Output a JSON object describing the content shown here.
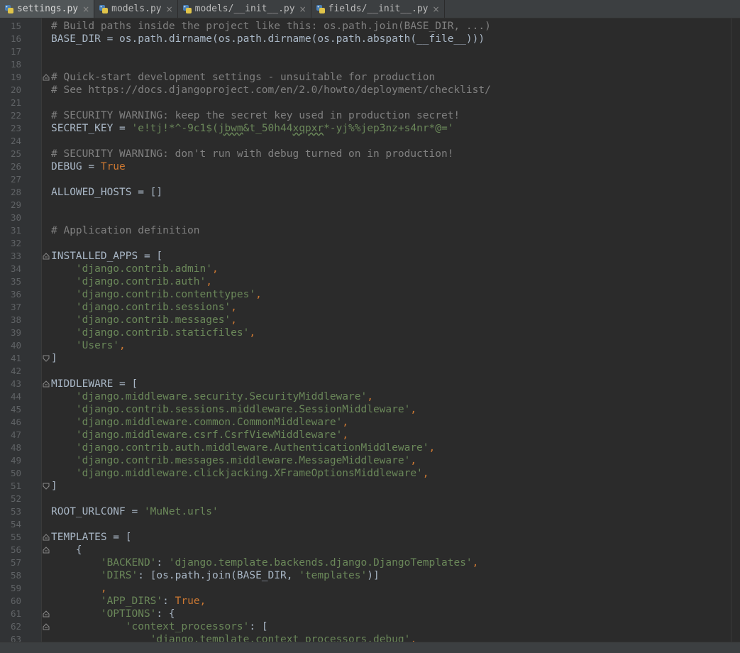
{
  "tabs": [
    {
      "name": "settings.py",
      "active": true
    },
    {
      "name": "models.py",
      "active": false
    },
    {
      "name": "models/__init__.py",
      "active": false
    },
    {
      "name": "fields/__init__.py",
      "active": false
    }
  ],
  "colors": {
    "background": "#2b2b2b",
    "gutter": "#313335",
    "comment": "#808080",
    "string": "#6a8759",
    "keyword": "#cc7832",
    "text": "#a9b7c6"
  },
  "code": {
    "lines": [
      {
        "n": "15",
        "t": "# Build paths inside the project like this: os.path.join(BASE_DIR, ...)",
        "k": "comment"
      },
      {
        "n": "16",
        "t": "BASE_DIR = os.path.dirname(os.path.dirname(os.path.abspath(__file__)))",
        "k": "plain"
      },
      {
        "n": "17",
        "t": "",
        "k": "plain"
      },
      {
        "n": "18",
        "t": "",
        "k": "plain"
      },
      {
        "n": "19",
        "t": "# Quick-start development settings - unsuitable for production",
        "k": "comment"
      },
      {
        "n": "20",
        "t": "# See https://docs.djangoproject.com/en/2.0/howto/deployment/checklist/",
        "k": "comment"
      },
      {
        "n": "21",
        "t": "",
        "k": "plain"
      },
      {
        "n": "22",
        "t": "# SECURITY WARNING: keep the secret key used in production secret!",
        "k": "comment"
      },
      {
        "n": "23",
        "t": "SECRET_KEY = 'e!tj!*^-9c1$(jbwm&t_50h44xqpxr*-yj%%jep3nz+s4nr*@='",
        "k": "assign-string"
      },
      {
        "n": "24",
        "t": "",
        "k": "plain"
      },
      {
        "n": "25",
        "t": "# SECURITY WARNING: don't run with debug turned on in production!",
        "k": "comment"
      },
      {
        "n": "26",
        "t": "DEBUG = True",
        "k": "assign-keyword"
      },
      {
        "n": "27",
        "t": "",
        "k": "plain"
      },
      {
        "n": "28",
        "t": "ALLOWED_HOSTS = []",
        "k": "plain"
      },
      {
        "n": "29",
        "t": "",
        "k": "plain"
      },
      {
        "n": "30",
        "t": "",
        "k": "plain"
      },
      {
        "n": "31",
        "t": "# Application definition",
        "k": "comment"
      },
      {
        "n": "32",
        "t": "",
        "k": "plain"
      },
      {
        "n": "33",
        "t": "INSTALLED_APPS = [",
        "k": "plain"
      },
      {
        "n": "34",
        "t": "    'django.contrib.admin',",
        "k": "string-comma"
      },
      {
        "n": "35",
        "t": "    'django.contrib.auth',",
        "k": "string-comma"
      },
      {
        "n": "36",
        "t": "    'django.contrib.contenttypes',",
        "k": "string-comma"
      },
      {
        "n": "37",
        "t": "    'django.contrib.sessions',",
        "k": "string-comma"
      },
      {
        "n": "38",
        "t": "    'django.contrib.messages',",
        "k": "string-comma"
      },
      {
        "n": "39",
        "t": "    'django.contrib.staticfiles',",
        "k": "string-comma"
      },
      {
        "n": "40",
        "t": "    'Users',",
        "k": "string-comma"
      },
      {
        "n": "41",
        "t": "]",
        "k": "plain"
      },
      {
        "n": "42",
        "t": "",
        "k": "plain"
      },
      {
        "n": "43",
        "t": "MIDDLEWARE = [",
        "k": "plain"
      },
      {
        "n": "44",
        "t": "    'django.middleware.security.SecurityMiddleware',",
        "k": "string-comma"
      },
      {
        "n": "45",
        "t": "    'django.contrib.sessions.middleware.SessionMiddleware',",
        "k": "string-comma"
      },
      {
        "n": "46",
        "t": "    'django.middleware.common.CommonMiddleware',",
        "k": "string-comma"
      },
      {
        "n": "47",
        "t": "    'django.middleware.csrf.CsrfViewMiddleware',",
        "k": "string-comma"
      },
      {
        "n": "48",
        "t": "    'django.contrib.auth.middleware.AuthenticationMiddleware',",
        "k": "string-comma"
      },
      {
        "n": "49",
        "t": "    'django.contrib.messages.middleware.MessageMiddleware',",
        "k": "string-comma"
      },
      {
        "n": "50",
        "t": "    'django.middleware.clickjacking.XFrameOptionsMiddleware',",
        "k": "string-comma"
      },
      {
        "n": "51",
        "t": "]",
        "k": "plain"
      },
      {
        "n": "52",
        "t": "",
        "k": "plain"
      },
      {
        "n": "53",
        "t": "ROOT_URLCONF = 'MuNet.urls'",
        "k": "assign-string"
      },
      {
        "n": "54",
        "t": "",
        "k": "plain"
      },
      {
        "n": "55",
        "t": "TEMPLATES = [",
        "k": "plain"
      },
      {
        "n": "56",
        "t": "    {",
        "k": "plain"
      },
      {
        "n": "57",
        "t": "        'BACKEND': 'django.template.backends.django.DjangoTemplates',",
        "k": "dict-string"
      },
      {
        "n": "58",
        "t": "        'DIRS': [os.path.join(BASE_DIR, 'templates')]",
        "k": "dict-dirs"
      },
      {
        "n": "59",
        "t": "        ,",
        "k": "comma"
      },
      {
        "n": "60",
        "t": "        'APP_DIRS': True,",
        "k": "dict-keyword"
      },
      {
        "n": "61",
        "t": "        'OPTIONS': {",
        "k": "dict-open"
      },
      {
        "n": "62",
        "t": "            'context_processors': [",
        "k": "dict-open"
      },
      {
        "n": "63",
        "t": "                'django.template.context_processors.debug',",
        "k": "string-comma"
      }
    ]
  }
}
